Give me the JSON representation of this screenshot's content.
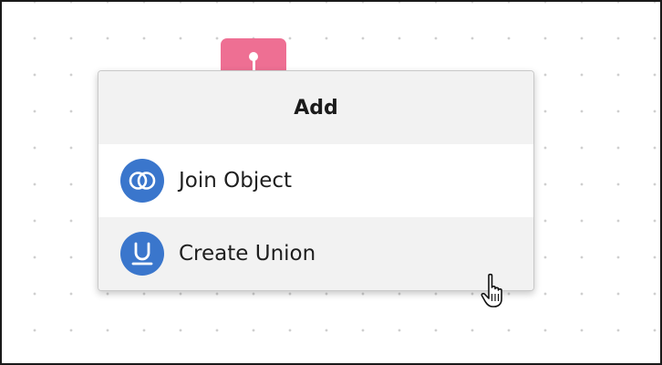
{
  "menu": {
    "title": "Add",
    "items": [
      {
        "label": "Join Object",
        "icon": "join-icon",
        "hovered": false
      },
      {
        "label": "Create Union",
        "icon": "union-icon",
        "hovered": true
      }
    ]
  },
  "colors": {
    "node_tab": "#ee6f93",
    "icon_background": "#3a76cc",
    "hover_background": "#f2f2f2"
  }
}
